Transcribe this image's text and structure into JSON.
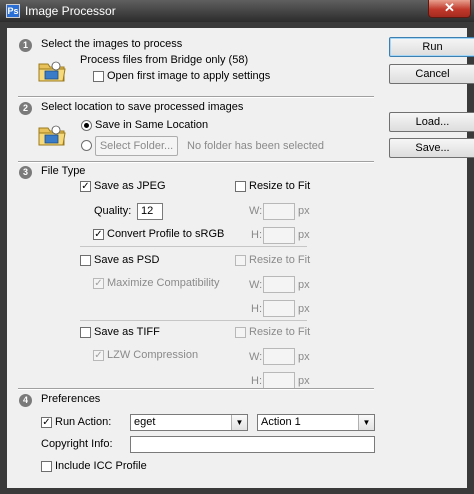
{
  "window": {
    "title": "Image Processor",
    "close_glyph": "✕",
    "icon_glyph": "Ps"
  },
  "buttons": {
    "run": "Run",
    "cancel": "Cancel",
    "load": "Load...",
    "save": "Save..."
  },
  "section1": {
    "number": "1",
    "title": "Select the images to process",
    "source_text": "Process files from Bridge only (58)",
    "open_first_label": "Open first image to apply settings",
    "open_first_checked": false
  },
  "section2": {
    "number": "2",
    "title": "Select location to save processed images",
    "same_location_label": "Save in Same Location",
    "same_location_selected": true,
    "select_folder_label": "Select Folder...",
    "no_folder_text": "No folder has been selected"
  },
  "section3": {
    "number": "3",
    "title": "File Type",
    "jpeg": {
      "label": "Save as JPEG",
      "checked": true,
      "resize_label": "Resize to Fit",
      "resize_checked": false,
      "quality_label": "Quality:",
      "quality_value": "12",
      "convert_label": "Convert Profile to sRGB",
      "convert_checked": true,
      "w_label": "W:",
      "h_label": "H:",
      "unit": "px"
    },
    "psd": {
      "label": "Save as PSD",
      "checked": false,
      "resize_label": "Resize to Fit",
      "resize_checked": false,
      "maximize_label": "Maximize Compatibility",
      "maximize_checked": true,
      "w_label": "W:",
      "h_label": "H:",
      "unit": "px"
    },
    "tiff": {
      "label": "Save as TIFF",
      "checked": false,
      "resize_label": "Resize to Fit",
      "resize_checked": false,
      "lzw_label": "LZW Compression",
      "lzw_checked": true,
      "w_label": "W:",
      "h_label": "H:",
      "unit": "px"
    }
  },
  "section4": {
    "number": "4",
    "title": "Preferences",
    "run_action_label": "Run Action:",
    "run_action_checked": true,
    "action_set": "eget",
    "action": "Action 1",
    "copyright_label": "Copyright Info:",
    "copyright_value": "",
    "icc_label": "Include ICC Profile",
    "icc_checked": false
  },
  "check_glyph": "✓",
  "dropdown_glyph": "▼"
}
